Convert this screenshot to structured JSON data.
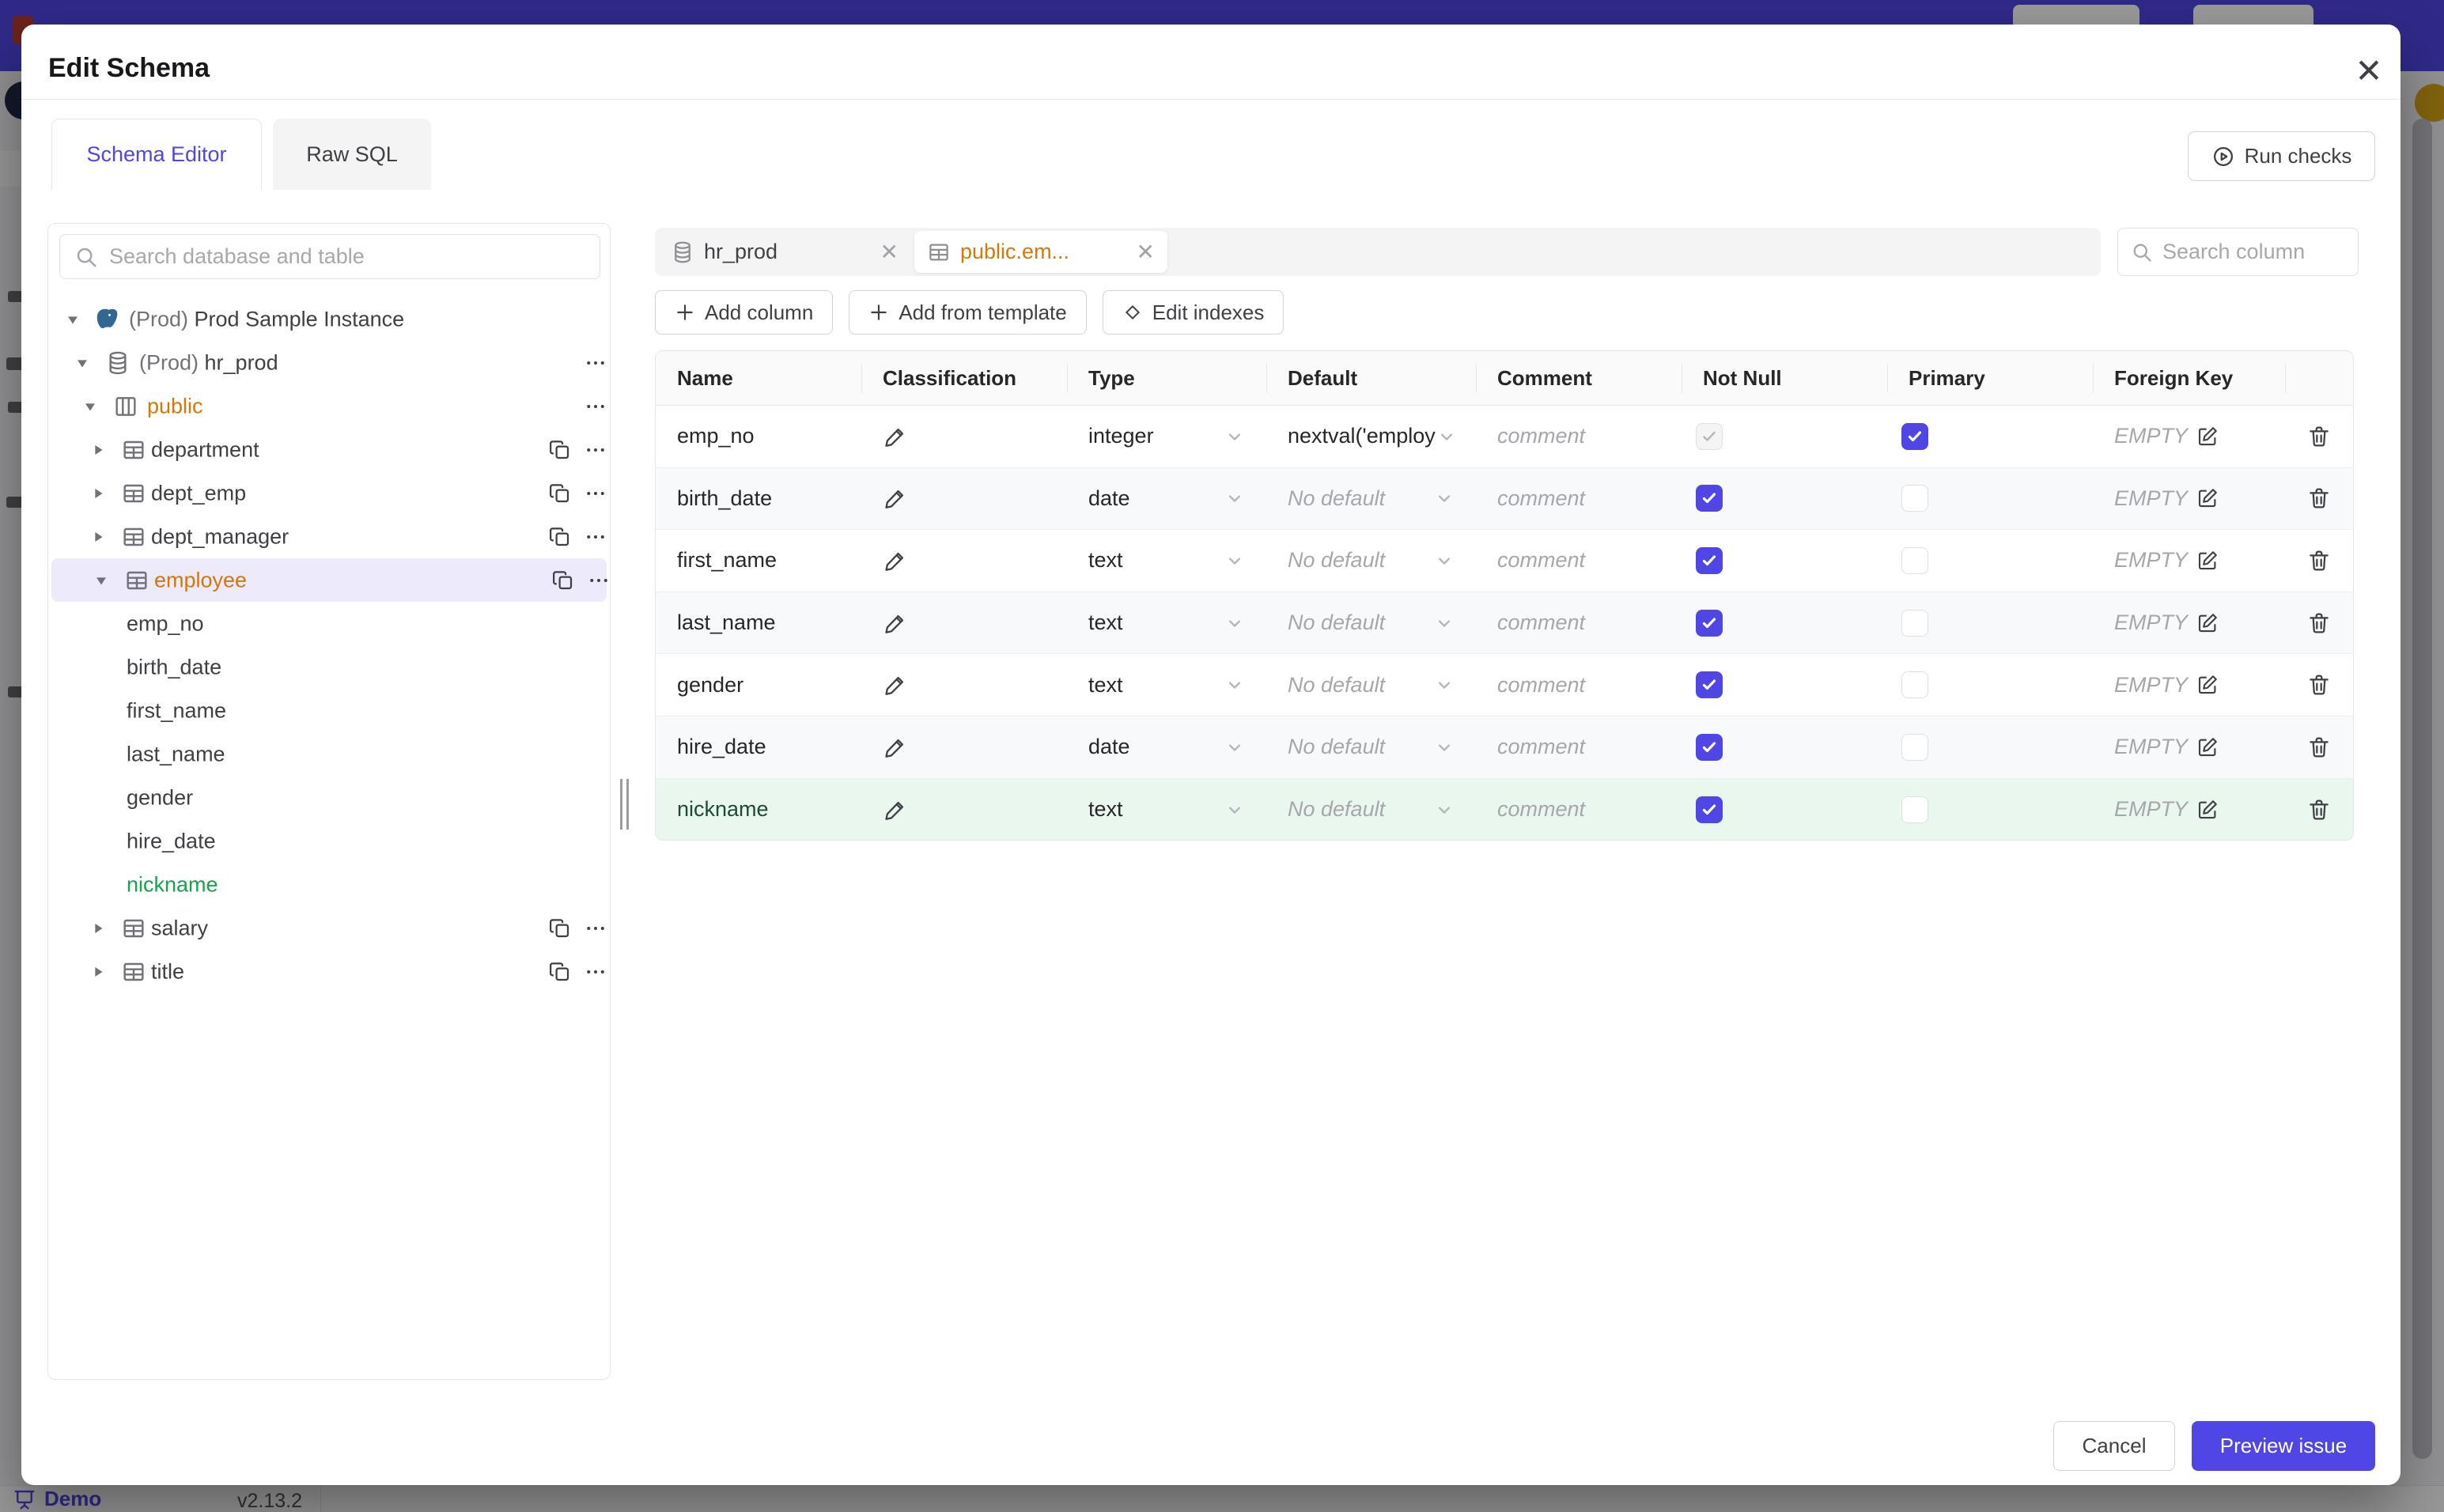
{
  "modal": {
    "title": "Edit Schema",
    "close_icon": "✕"
  },
  "tabs": [
    {
      "label": "Schema Editor",
      "active": true
    },
    {
      "label": "Raw SQL",
      "active": false
    }
  ],
  "toolbar": {
    "run_checks_label": "Run checks"
  },
  "sidebar": {
    "search_placeholder": "Search database and table",
    "tree": [
      {
        "level": "instance",
        "caret": "down",
        "icon": "postgres",
        "prefix": "(Prod) ",
        "label": "Prod Sample Instance",
        "color": "default",
        "copy": false,
        "more": false
      },
      {
        "level": "db",
        "caret": "down",
        "icon": "database",
        "prefix": "(Prod) ",
        "label": "hr_prod",
        "color": "default",
        "copy": false,
        "more": true
      },
      {
        "level": "schema",
        "caret": "down",
        "icon": "schema",
        "prefix": "",
        "label": "public",
        "color": "accent",
        "copy": false,
        "more": true
      },
      {
        "level": "table",
        "caret": "right",
        "icon": "table",
        "prefix": "",
        "label": "department",
        "color": "default",
        "copy": true,
        "more": true
      },
      {
        "level": "table",
        "caret": "right",
        "icon": "table",
        "prefix": "",
        "label": "dept_emp",
        "color": "default",
        "copy": true,
        "more": true
      },
      {
        "level": "table",
        "caret": "right",
        "icon": "table",
        "prefix": "",
        "label": "dept_manager",
        "color": "default",
        "copy": true,
        "more": true
      },
      {
        "level": "table",
        "caret": "down",
        "icon": "table",
        "prefix": "",
        "label": "employee",
        "color": "accent",
        "copy": true,
        "more": true,
        "selected": true
      },
      {
        "level": "column",
        "caret": "none",
        "icon": "none",
        "prefix": "",
        "label": "emp_no",
        "color": "default"
      },
      {
        "level": "column",
        "caret": "none",
        "icon": "none",
        "prefix": "",
        "label": "birth_date",
        "color": "default"
      },
      {
        "level": "column",
        "caret": "none",
        "icon": "none",
        "prefix": "",
        "label": "first_name",
        "color": "default"
      },
      {
        "level": "column",
        "caret": "none",
        "icon": "none",
        "prefix": "",
        "label": "last_name",
        "color": "default"
      },
      {
        "level": "column",
        "caret": "none",
        "icon": "none",
        "prefix": "",
        "label": "gender",
        "color": "default"
      },
      {
        "level": "column",
        "caret": "none",
        "icon": "none",
        "prefix": "",
        "label": "hire_date",
        "color": "default"
      },
      {
        "level": "column",
        "caret": "none",
        "icon": "none",
        "prefix": "",
        "label": "nickname",
        "color": "green"
      },
      {
        "level": "table",
        "caret": "right",
        "icon": "table",
        "prefix": "",
        "label": "salary",
        "color": "default",
        "copy": true,
        "more": true
      },
      {
        "level": "table",
        "caret": "right",
        "icon": "table",
        "prefix": "",
        "label": "title",
        "color": "default",
        "copy": true,
        "more": true
      }
    ]
  },
  "editor": {
    "chips": [
      {
        "label": "hr_prod",
        "icon": "database",
        "active": false
      },
      {
        "label": "public.em...",
        "icon": "table",
        "active": true
      }
    ],
    "column_search_placeholder": "Search column",
    "actions": [
      {
        "label": "Add column",
        "icon": "plus"
      },
      {
        "label": "Add from template",
        "icon": "plus"
      },
      {
        "label": "Edit indexes",
        "icon": "diamond"
      }
    ]
  },
  "table": {
    "headers": [
      "Name",
      "Classification",
      "Type",
      "Default",
      "Comment",
      "Not Null",
      "Primary",
      "Foreign Key",
      ""
    ],
    "comment_placeholder": "comment",
    "foreign_key_placeholder": "EMPTY",
    "rows": [
      {
        "name": "emp_no",
        "type": "integer",
        "default": "nextval('employ",
        "default_muted": false,
        "not_null_checked": true,
        "not_null_disabled": true,
        "primary": true,
        "is_new": false
      },
      {
        "name": "birth_date",
        "type": "date",
        "default": "No default",
        "default_muted": true,
        "not_null_checked": true,
        "not_null_disabled": false,
        "primary": false,
        "is_new": false
      },
      {
        "name": "first_name",
        "type": "text",
        "default": "No default",
        "default_muted": true,
        "not_null_checked": true,
        "not_null_disabled": false,
        "primary": false,
        "is_new": false
      },
      {
        "name": "last_name",
        "type": "text",
        "default": "No default",
        "default_muted": true,
        "not_null_checked": true,
        "not_null_disabled": false,
        "primary": false,
        "is_new": false
      },
      {
        "name": "gender",
        "type": "text",
        "default": "No default",
        "default_muted": true,
        "not_null_checked": true,
        "not_null_disabled": false,
        "primary": false,
        "is_new": false
      },
      {
        "name": "hire_date",
        "type": "date",
        "default": "No default",
        "default_muted": true,
        "not_null_checked": true,
        "not_null_disabled": false,
        "primary": false,
        "is_new": false
      },
      {
        "name": "nickname",
        "type": "text",
        "default": "No default",
        "default_muted": true,
        "not_null_checked": true,
        "not_null_disabled": false,
        "primary": false,
        "is_new": true
      }
    ]
  },
  "footer": {
    "cancel_label": "Cancel",
    "submit_label": "Preview issue"
  },
  "background": {
    "demo_label": "Demo",
    "version": "v2.13.2"
  },
  "colors": {
    "accent": "#4f46e5",
    "schema_highlight": "#d97706",
    "new_item_green": "#16a34a",
    "new_row_bg": "#e9f7ef",
    "selected_tree_bg": "#eceafb"
  }
}
